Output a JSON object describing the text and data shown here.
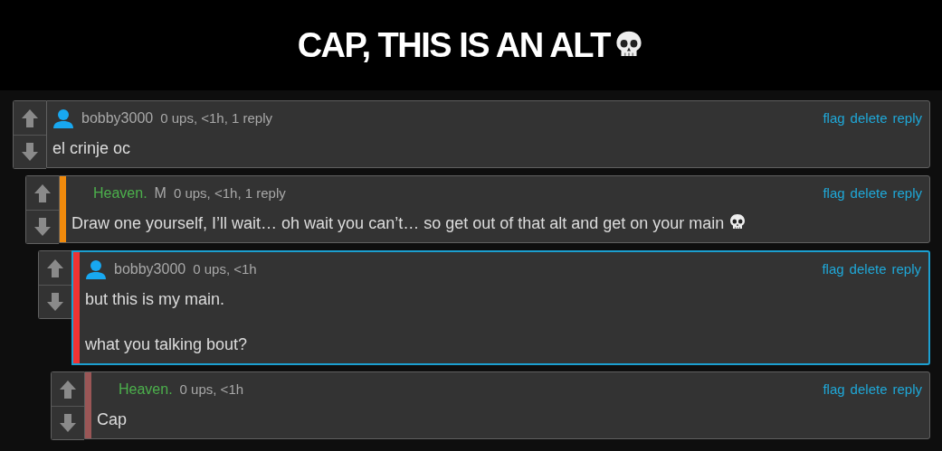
{
  "caption": {
    "text": "CAP, THIS IS AN ALT",
    "ends_with_skull": true
  },
  "comments": [
    {
      "author": {
        "name": "bobby3000",
        "color": "#a8a8a8"
      },
      "has_avatar": true,
      "meta": "0 ups, <1h, 1 reply",
      "actions": [
        "flag",
        "delete",
        "reply"
      ],
      "paragraphs": [
        "el crinje oc"
      ],
      "ends_with_skull": false,
      "highlighted": false,
      "children": [
        {
          "author": {
            "name": "Heaven.",
            "color": "#4cb04c"
          },
          "has_avatar": false,
          "badge": "M",
          "meta": "0 ups, <1h, 1 reply",
          "actions": [
            "flag",
            "delete",
            "reply"
          ],
          "bar": {
            "color": "#f08a0c"
          },
          "paragraphs": [
            "Draw one yourself, I’ll wait… oh wait you can’t… so get out of that alt and get on your main"
          ],
          "ends_with_skull": true,
          "highlighted": false,
          "children": [
            {
              "author": {
                "name": "bobby3000",
                "color": "#a8a8a8"
              },
              "has_avatar": true,
              "meta": "0 ups, <1h",
              "actions": [
                "flag",
                "delete",
                "reply"
              ],
              "bar": {
                "color": "#ee3333"
              },
              "paragraphs": [
                "but this is my main.",
                "what you talking bout?"
              ],
              "ends_with_skull": false,
              "highlighted": true,
              "children": [
                {
                  "author": {
                    "name": "Heaven.",
                    "color": "#4cb04c"
                  },
                  "has_avatar": false,
                  "meta": "0 ups, <1h",
                  "actions": [
                    "flag",
                    "delete",
                    "reply"
                  ],
                  "bar": {
                    "color": "#9a5656"
                  },
                  "paragraphs": [
                    "Cap"
                  ],
                  "ends_with_skull": false,
                  "highlighted": false
                }
              ]
            }
          ]
        }
      ]
    }
  ]
}
